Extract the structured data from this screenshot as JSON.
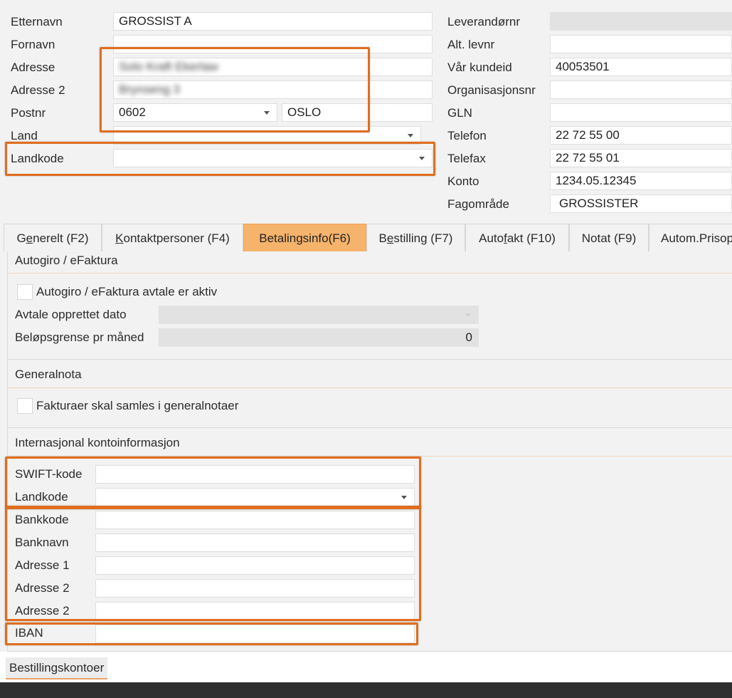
{
  "left_fields": {
    "etternavn_label": "Etternavn",
    "etternavn_value": "GROSSIST A",
    "fornavn_label": "Fornavn",
    "fornavn_value": "",
    "adresse_label": "Adresse",
    "adresse_value": "Solo Kraft Ekerlaw",
    "adresse2_label": "Adresse 2",
    "adresse2_value": "Brynseng 3",
    "postnr_label": "Postnr",
    "postnr_value": "0602",
    "poststed_value": "OSLO",
    "land_label": "Land",
    "land_value": "",
    "landkode_label": "Landkode",
    "landkode_value": ""
  },
  "right_fields": {
    "leverandornr_label": "Leverandørnr",
    "leverandornr_value": "",
    "alt_levnr_label": "Alt. levnr",
    "alt_levnr_value": "",
    "var_kundeid_label": "Vår kundeid",
    "var_kundeid_value": "40053501",
    "orgnr_label": "Organisasjonsnr",
    "orgnr_value": "",
    "gln_label": "GLN",
    "gln_value": "",
    "telefon_label": "Telefon",
    "telefon_value": "22 72 55 00",
    "telefax_label": "Telefax",
    "telefax_value": "22 72 55 01",
    "konto_label": "Konto",
    "konto_value": "1234.05.12345",
    "fagomrade_label": "Fagområde",
    "fagomrade_value": "GROSSISTER"
  },
  "tabs": [
    {
      "pre": "G",
      "u": "e",
      "post": "nerelt (F2)"
    },
    {
      "pre": "",
      "u": "K",
      "post": "ontaktpersoner (F4)"
    },
    {
      "pre": "Betalingsinfo(F6)",
      "u": "",
      "post": ""
    },
    {
      "pre": "B",
      "u": "e",
      "post": "stilling (F7)"
    },
    {
      "pre": "Auto",
      "u": "f",
      "post": "akt (F10)"
    },
    {
      "pre": "Notat (F9)",
      "u": "",
      "post": ""
    },
    {
      "pre": "Autom.Prisop",
      "u": "",
      "post": ""
    }
  ],
  "autogiro": {
    "title": "Autogiro / eFaktura",
    "checkbox_label": "Autogiro / eFaktura avtale er aktiv",
    "avtale_label": "Avtale opprettet dato",
    "avtale_value": "",
    "belop_label": "Beløpsgrense pr måned",
    "belop_value": "0"
  },
  "generalnota": {
    "title": "Generalnota",
    "checkbox_label": "Fakturaer skal samles i generalnotaer"
  },
  "intl": {
    "title": "Internasjonal kontoinformasjon",
    "swift_label": "SWIFT-kode",
    "landkode_label": "Landkode",
    "bankkode_label": "Bankkode",
    "banknavn_label": "Banknavn",
    "adresse1_label": "Adresse 1",
    "adresse2_label": "Adresse 2",
    "adresse3_label": "Adresse 2",
    "iban_label": "IBAN"
  },
  "bottom": {
    "bestillingskontoer_label": "Bestillingskontoer"
  },
  "colors": {
    "highlight": "#e06e1f",
    "active_tab": "#f6b36b",
    "status_bar": "#2f2f2f"
  }
}
